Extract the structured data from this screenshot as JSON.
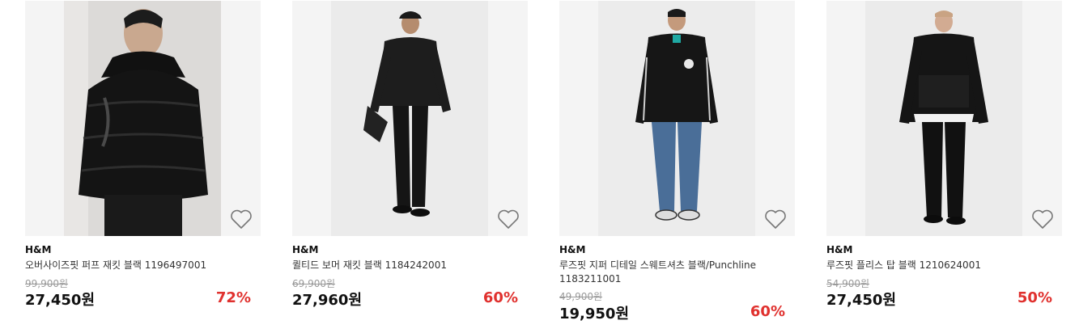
{
  "products": [
    {
      "brand": "H&M",
      "name": "오버사이즈핏 퍼프 재킷 블랙 1196497001",
      "original_price": "99,900원",
      "price": "27,450원",
      "discount": "72%",
      "icon": "heart-outline-icon"
    },
    {
      "brand": "H&M",
      "name": "퀼티드 보머 재킷 블랙 1184242001",
      "original_price": "69,900원",
      "price": "27,960원",
      "discount": "60%",
      "icon": "heart-outline-icon"
    },
    {
      "brand": "H&M",
      "name": "루즈핏 지퍼 디테일 스웨트셔츠 블랙/Punchline 1183211001",
      "original_price": "49,900원",
      "price": "19,950원",
      "discount": "60%",
      "icon": "heart-outline-icon"
    },
    {
      "brand": "H&M",
      "name": "루즈핏 플리스 탑 블랙 1210624001",
      "original_price": "54,900원",
      "price": "27,450원",
      "discount": "50%",
      "icon": "heart-outline-icon"
    }
  ],
  "colors": {
    "discount": "#e0312e",
    "strikethrough": "#999999",
    "image_bg": "#f4f4f4"
  }
}
